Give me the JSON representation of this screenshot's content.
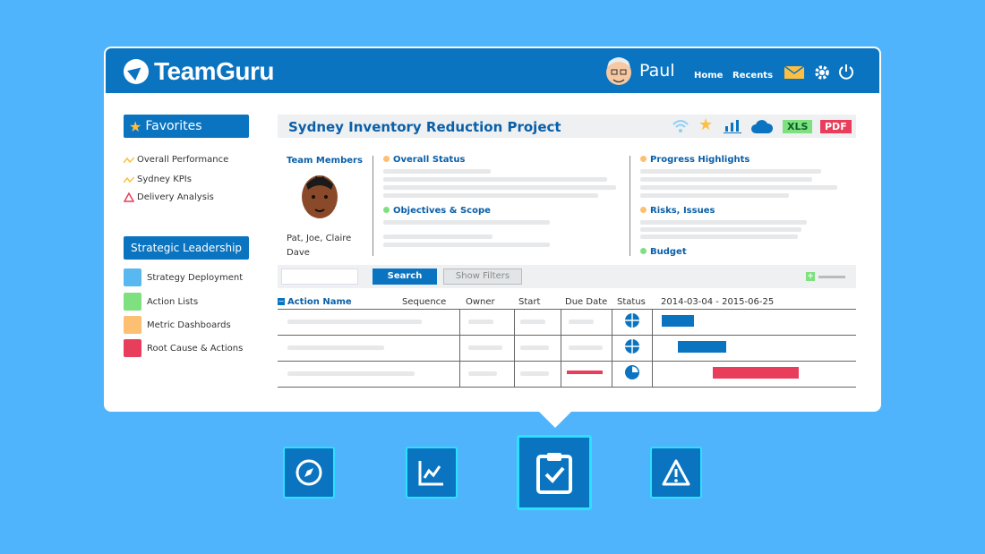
{
  "app": {
    "name": "TeamGuru"
  },
  "header": {
    "user_name": "Paul",
    "nav": {
      "home": "Home",
      "recents": "Recents"
    },
    "icons": [
      "mail-icon",
      "gear-icon",
      "power-icon"
    ]
  },
  "sidebar": {
    "favorites_title": "Favorites",
    "favorites": [
      {
        "label": "Overall Performance",
        "icon": "trend-icon"
      },
      {
        "label": "Sydney KPIs",
        "icon": "trend-icon"
      },
      {
        "label": "Delivery Analysis",
        "icon": "warning-triangle-icon"
      }
    ],
    "section_title": "Strategic Leadership",
    "items": [
      {
        "label": "Strategy Deployment",
        "color": "#5ab8f0"
      },
      {
        "label": "Action Lists",
        "color": "#7fe07f"
      },
      {
        "label": "Metric Dashboards",
        "color": "#fdbf72"
      },
      {
        "label": "Root Cause & Actions",
        "color": "#e83e5c"
      }
    ]
  },
  "project": {
    "title": "Sydney Inventory Reduction Project",
    "export_xls": "XLS",
    "export_pdf": "PDF",
    "team_label": "Team Members",
    "team_names_line1": "Pat, Joe, Claire",
    "team_names_line2": "Dave",
    "sections": {
      "overall_status": "Overall Status",
      "objectives": "Objectives & Scope",
      "progress": "Progress Highlights",
      "risks": "Risks, Issues",
      "budget": "Budget"
    }
  },
  "filters": {
    "search_label": "Search",
    "show_filters_label": "Show Filters"
  },
  "table": {
    "headers": {
      "action_name": "Action Name",
      "sequence": "Sequence",
      "owner": "Owner",
      "start": "Start",
      "due_date": "Due Date",
      "status": "Status",
      "date_range": "2014-03-04 - 2015-06-25"
    },
    "rows": [
      {
        "status": "three-quarter-pie-icon",
        "bar_color": "#0a74c1",
        "overdue": false
      },
      {
        "status": "three-quarter-pie-icon",
        "bar_color": "#0a74c1",
        "overdue": false
      },
      {
        "status": "quarter-pie-icon",
        "bar_color": "#e83e5c",
        "overdue": true
      }
    ]
  },
  "colors": {
    "brand": "#0a74c1",
    "accent_red": "#e83e5c",
    "background": "#4fb4fb"
  },
  "bottom_icons": [
    "compass-icon",
    "chart-icon",
    "clipboard-check-icon",
    "warning-icon"
  ]
}
